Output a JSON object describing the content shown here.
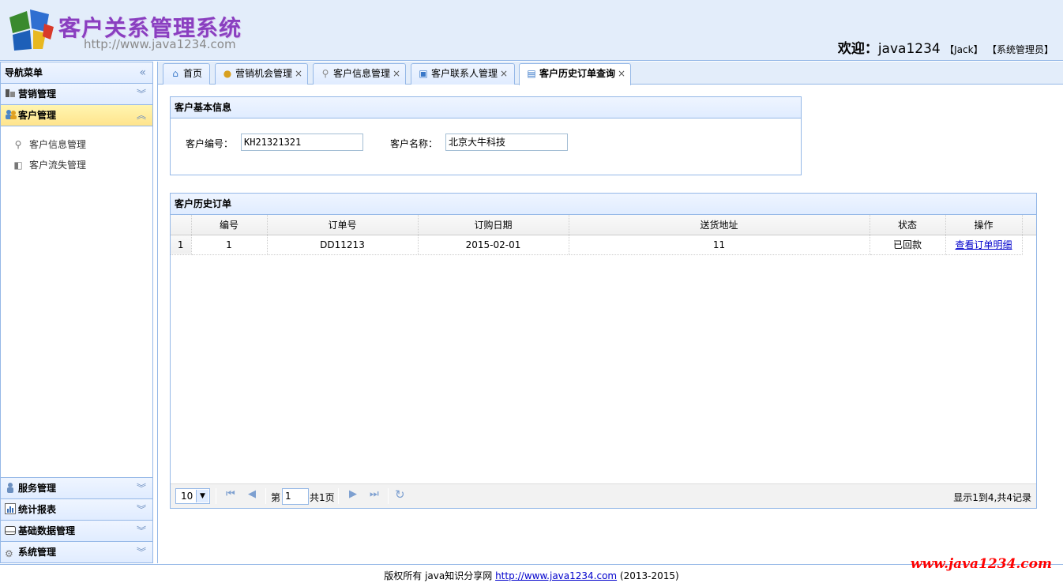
{
  "header": {
    "title": "客户关系管理系统",
    "url": "http://www.java1234.com",
    "welcome_label": "欢迎：",
    "username": "java1234",
    "user_tag": "【Jack】",
    "role_tag": "【系统管理员】"
  },
  "sidebar": {
    "title": "导航菜单",
    "collapse_icon": "double-chevron-left",
    "sections": [
      {
        "label": "营销管理",
        "icon": "marketing-icon"
      },
      {
        "label": "客户管理",
        "icon": "customer-icon"
      }
    ],
    "items": [
      {
        "label": "客户信息管理",
        "icon": "person-icon"
      },
      {
        "label": "客户流失管理",
        "icon": "customer-loss-icon"
      }
    ],
    "bottom_sections": [
      {
        "label": "服务管理",
        "icon": "service-icon"
      },
      {
        "label": "统计报表",
        "icon": "report-icon"
      },
      {
        "label": "基础数据管理",
        "icon": "database-icon"
      },
      {
        "label": "系统管理",
        "icon": "gear-icon"
      }
    ]
  },
  "tabs": [
    {
      "label": "首页",
      "icon": "home-icon",
      "closable": false
    },
    {
      "label": "营销机会管理",
      "icon": "coins-icon",
      "closable": true
    },
    {
      "label": "客户信息管理",
      "icon": "person-icon",
      "closable": true
    },
    {
      "label": "客户联系人管理",
      "icon": "contact-icon",
      "closable": true
    },
    {
      "label": "客户历史订单查询",
      "icon": "contact-card-icon",
      "closable": true,
      "active": true
    }
  ],
  "tab_close_glyph": "×",
  "basic_info": {
    "title": "客户基本信息",
    "no_label": "客户编号：",
    "no_value": "KH21321321",
    "name_label": "客户名称：",
    "name_value": "北京大牛科技"
  },
  "orders": {
    "title": "客户历史订单",
    "columns": [
      "编号",
      "订单号",
      "订购日期",
      "送货地址",
      "状态",
      "操作"
    ],
    "rows": [
      {
        "rownum": "1",
        "id": "1",
        "order_no": "DD11213",
        "date": "2015-02-01",
        "address": "11",
        "status": "已回款",
        "action": "查看订单明细"
      }
    ]
  },
  "pager": {
    "page_size": "10",
    "page_prefix": "第",
    "page_value": "1",
    "page_suffix": "共1页",
    "summary": "显示1到4,共4记录"
  },
  "footer": {
    "text": "版权所有 java知识分享网 ",
    "link": "http://www.java1234.com",
    "years": " (2013-2015)"
  },
  "watermark": "www.java1234.com",
  "colors": {
    "border": "#95b8e7",
    "header_bg": "#e3edfa",
    "title_purple": "#8a3fc0",
    "active_section": "#ffe48d",
    "link": "#0000cc"
  }
}
